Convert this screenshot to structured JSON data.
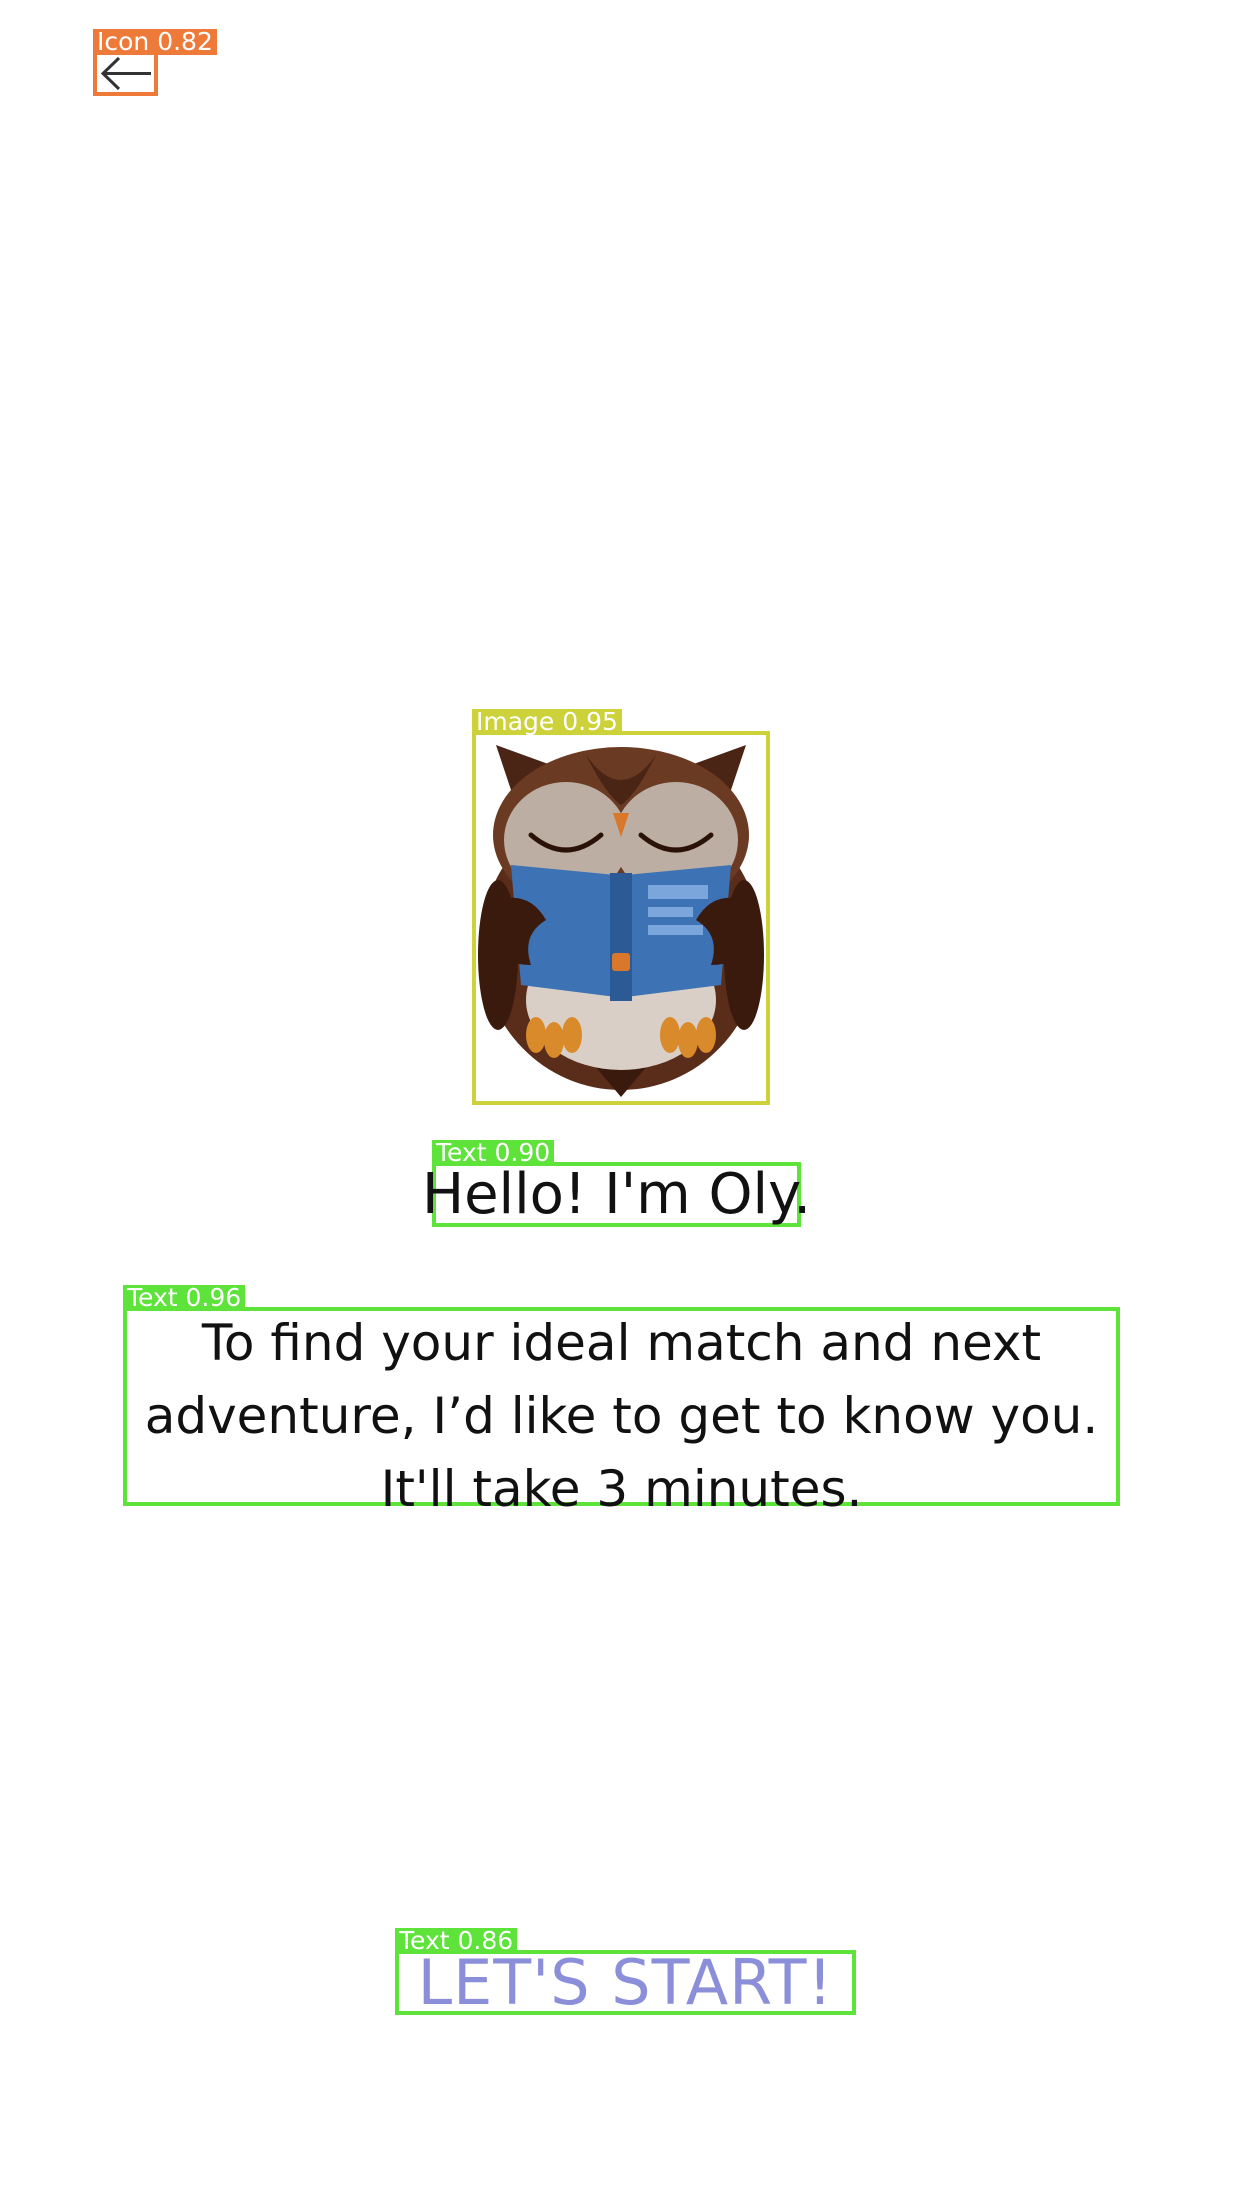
{
  "overlay_labels": {
    "back_icon": "Icon 0.82",
    "owl_image": "Image 0.95",
    "greeting": "Text 0.90",
    "intro": "Text 0.96",
    "start": "Text 0.86"
  },
  "nav": {
    "back_icon": "arrow-left-icon"
  },
  "hero": {
    "image_icon": "owl-reading-book",
    "greeting": "Hello! I'm Oly.",
    "intro_lines": [
      "To find your ideal match and next",
      "adventure, I’d like to get to know you.",
      "It'll take 3 minutes."
    ]
  },
  "actions": {
    "start_label": "LET'S START!"
  },
  "colors": {
    "background": "#ffffff",
    "text": "#111111",
    "start_button": "#8b8fd9",
    "icon_box": "#ee7a3a",
    "image_box": "#cdd23a",
    "text_box": "#5ee33a"
  }
}
